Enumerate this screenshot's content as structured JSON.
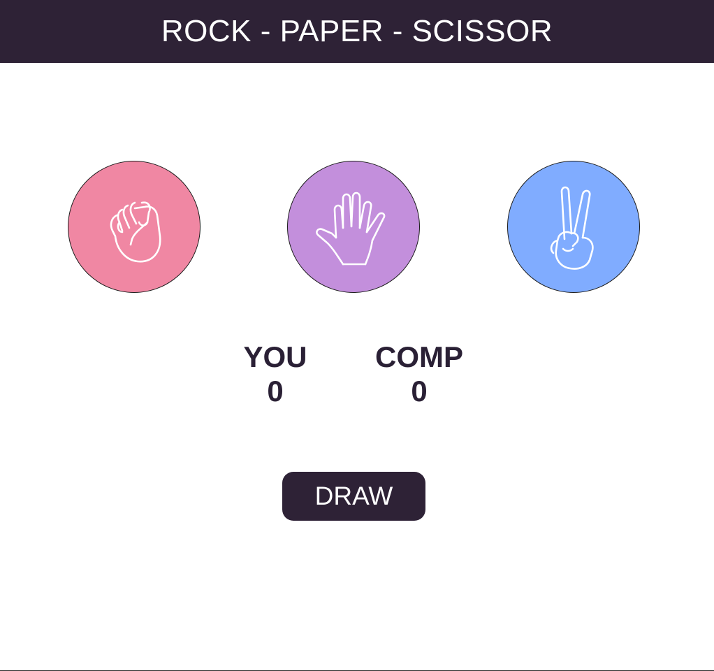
{
  "header": {
    "title": "ROCK - PAPER - SCISSOR"
  },
  "colors": {
    "header_bg": "#2e2236",
    "rock": "#f087a3",
    "paper": "#c38fdc",
    "scissor": "#80acff",
    "button_bg": "#2e2236"
  },
  "choices": [
    {
      "id": "rock",
      "icon": "fist-icon"
    },
    {
      "id": "paper",
      "icon": "open-hand-icon"
    },
    {
      "id": "scissor",
      "icon": "peace-sign-icon"
    }
  ],
  "scoreboard": {
    "you": {
      "label": "YOU",
      "value": "0"
    },
    "comp": {
      "label": "COMP",
      "value": "0"
    }
  },
  "result": {
    "label": "DRAW"
  }
}
